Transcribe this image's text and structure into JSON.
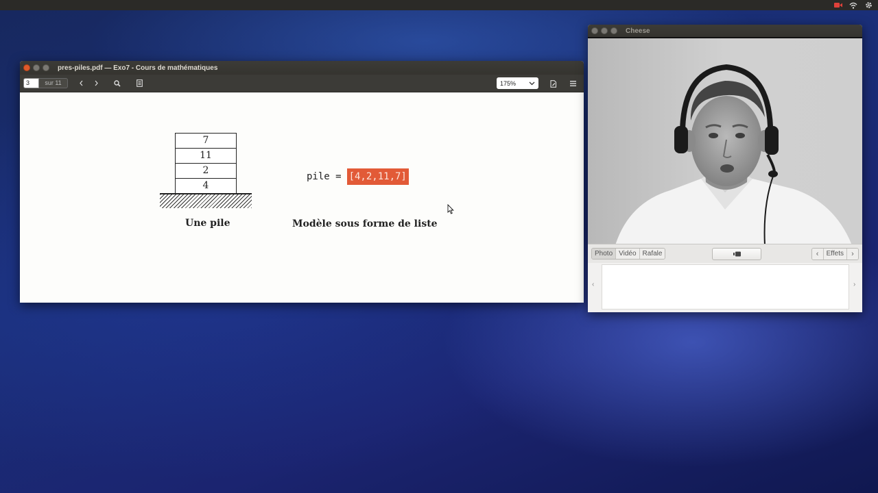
{
  "panel": {
    "icons": [
      "camera-recording-icon",
      "wifi-icon",
      "settings-gear-icon"
    ],
    "recording_color": "#e0413a"
  },
  "pdf_viewer": {
    "title": "pres-piles.pdf — Exo7 - Cours de mathématiques",
    "page_current": "3",
    "page_total": "sur 11",
    "zoom": "175%",
    "content": {
      "stack_values": [
        "7",
        "11",
        "2",
        "4"
      ],
      "stack_caption": "Une pile",
      "code_prefix": "pile =",
      "code_list": "[4,2,11,7]",
      "model_caption": "Modèle sous forme de liste",
      "highlight_color": "#e25a37"
    }
  },
  "cheese": {
    "title": "Cheese",
    "modes": [
      "Photo",
      "Vidéo",
      "Rafale"
    ],
    "active_mode": "Photo",
    "effects_label": "Effets"
  }
}
